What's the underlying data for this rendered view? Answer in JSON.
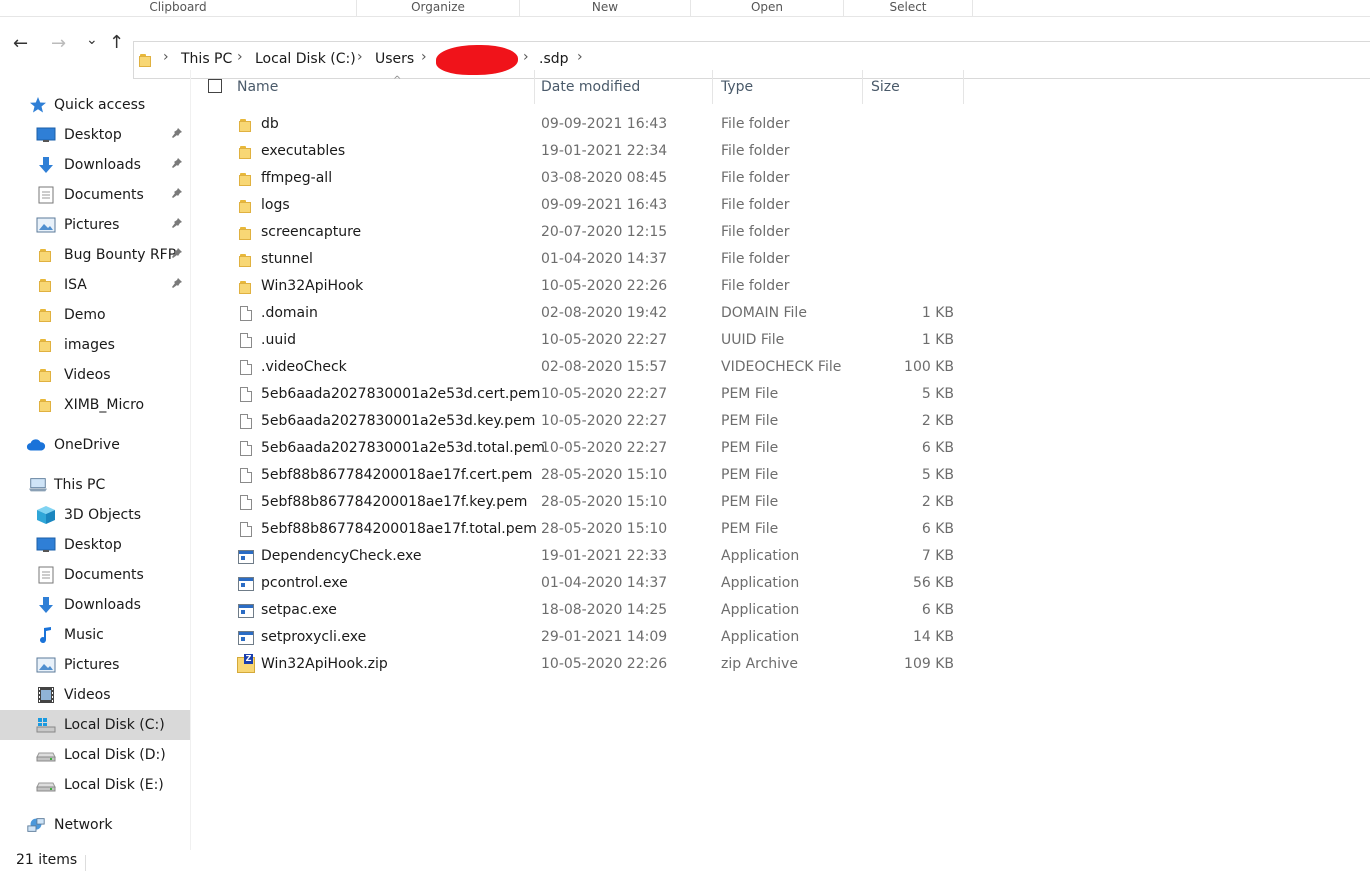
{
  "ribbon": [
    "Clipboard",
    "Organize",
    "New",
    "Open",
    "Select"
  ],
  "nav": {
    "back": "←",
    "forward": "→",
    "recent": "⌄",
    "up": "↑",
    "breadcrumbs": [
      "This PC",
      "Local Disk (C:)",
      "Users",
      ".sdp"
    ],
    "sep": "›"
  },
  "columns": {
    "name": "Name",
    "date": "Date modified",
    "type": "Type",
    "size": "Size",
    "sort_indicator": "^"
  },
  "sidebar": {
    "pin_glyph": "📌",
    "items": [
      {
        "label": "Quick access",
        "icon": "star-icon",
        "pinned": false
      },
      {
        "label": "Desktop",
        "icon": "desktop-icon",
        "pinned": true
      },
      {
        "label": "Downloads",
        "icon": "download-icon",
        "pinned": true
      },
      {
        "label": "Documents",
        "icon": "document-icon",
        "pinned": true
      },
      {
        "label": "Pictures",
        "icon": "picture-icon",
        "pinned": true
      },
      {
        "label": "Bug Bounty RFP",
        "icon": "folder-icon",
        "pinned": true
      },
      {
        "label": "ISA",
        "icon": "folder-icon",
        "pinned": true
      },
      {
        "label": "Demo",
        "icon": "folder-icon",
        "pinned": false
      },
      {
        "label": "images",
        "icon": "folder-icon",
        "pinned": false
      },
      {
        "label": "Videos",
        "icon": "folder-icon",
        "pinned": false
      },
      {
        "label": "XIMB_Micro",
        "icon": "folder-icon",
        "pinned": false
      },
      {
        "label": "OneDrive",
        "icon": "cloud-icon",
        "pinned": false
      },
      {
        "label": "This PC",
        "icon": "computer-icon",
        "pinned": false
      },
      {
        "label": "3D Objects",
        "icon": "cube-icon",
        "pinned": false
      },
      {
        "label": "Desktop",
        "icon": "desktop-icon",
        "pinned": false
      },
      {
        "label": "Documents",
        "icon": "document-icon",
        "pinned": false
      },
      {
        "label": "Downloads",
        "icon": "download-icon",
        "pinned": false
      },
      {
        "label": "Music",
        "icon": "music-icon",
        "pinned": false
      },
      {
        "label": "Pictures",
        "icon": "picture-icon",
        "pinned": false
      },
      {
        "label": "Videos",
        "icon": "video-icon",
        "pinned": false
      },
      {
        "label": "Local Disk (C:)",
        "icon": "windows-drive-icon",
        "pinned": false,
        "selected": true
      },
      {
        "label": "Local Disk (D:)",
        "icon": "drive-icon",
        "pinned": false
      },
      {
        "label": "Local Disk (E:)",
        "icon": "drive-icon",
        "pinned": false
      },
      {
        "label": "Network",
        "icon": "network-icon",
        "pinned": false
      }
    ]
  },
  "files": [
    {
      "name": "db",
      "date": "09-09-2021 16:43",
      "type": "File folder",
      "size": "",
      "kind": "folder"
    },
    {
      "name": "executables",
      "date": "19-01-2021 22:34",
      "type": "File folder",
      "size": "",
      "kind": "folder"
    },
    {
      "name": "ffmpeg-all",
      "date": "03-08-2020 08:45",
      "type": "File folder",
      "size": "",
      "kind": "folder"
    },
    {
      "name": "logs",
      "date": "09-09-2021 16:43",
      "type": "File folder",
      "size": "",
      "kind": "folder"
    },
    {
      "name": "screencapture",
      "date": "20-07-2020 12:15",
      "type": "File folder",
      "size": "",
      "kind": "folder"
    },
    {
      "name": "stunnel",
      "date": "01-04-2020 14:37",
      "type": "File folder",
      "size": "",
      "kind": "folder"
    },
    {
      "name": "Win32ApiHook",
      "date": "10-05-2020 22:26",
      "type": "File folder",
      "size": "",
      "kind": "folder"
    },
    {
      "name": ".domain",
      "date": "02-08-2020 19:42",
      "type": "DOMAIN File",
      "size": "1 KB",
      "kind": "file"
    },
    {
      "name": ".uuid",
      "date": "10-05-2020 22:27",
      "type": "UUID File",
      "size": "1 KB",
      "kind": "file"
    },
    {
      "name": ".videoCheck",
      "date": "02-08-2020 15:57",
      "type": "VIDEOCHECK File",
      "size": "100 KB",
      "kind": "file"
    },
    {
      "name": "5eb6aada2027830001a2e53d.cert.pem",
      "date": "10-05-2020 22:27",
      "type": "PEM File",
      "size": "5 KB",
      "kind": "file"
    },
    {
      "name": "5eb6aada2027830001a2e53d.key.pem",
      "date": "10-05-2020 22:27",
      "type": "PEM File",
      "size": "2 KB",
      "kind": "file"
    },
    {
      "name": "5eb6aada2027830001a2e53d.total.pem",
      "date": "10-05-2020 22:27",
      "type": "PEM File",
      "size": "6 KB",
      "kind": "file"
    },
    {
      "name": "5ebf88b867784200018ae17f.cert.pem",
      "date": "28-05-2020 15:10",
      "type": "PEM File",
      "size": "5 KB",
      "kind": "file"
    },
    {
      "name": "5ebf88b867784200018ae17f.key.pem",
      "date": "28-05-2020 15:10",
      "type": "PEM File",
      "size": "2 KB",
      "kind": "file"
    },
    {
      "name": "5ebf88b867784200018ae17f.total.pem",
      "date": "28-05-2020 15:10",
      "type": "PEM File",
      "size": "6 KB",
      "kind": "file"
    },
    {
      "name": "DependencyCheck.exe",
      "date": "19-01-2021 22:33",
      "type": "Application",
      "size": "7 KB",
      "kind": "app"
    },
    {
      "name": "pcontrol.exe",
      "date": "01-04-2020 14:37",
      "type": "Application",
      "size": "56 KB",
      "kind": "app"
    },
    {
      "name": "setpac.exe",
      "date": "18-08-2020 14:25",
      "type": "Application",
      "size": "6 KB",
      "kind": "app"
    },
    {
      "name": "setproxycli.exe",
      "date": "29-01-2021 14:09",
      "type": "Application",
      "size": "14 KB",
      "kind": "app"
    },
    {
      "name": "Win32ApiHook.zip",
      "date": "10-05-2020 22:26",
      "type": "zip Archive",
      "size": "109 KB",
      "kind": "zip"
    }
  ],
  "status": {
    "count": "21 items"
  }
}
